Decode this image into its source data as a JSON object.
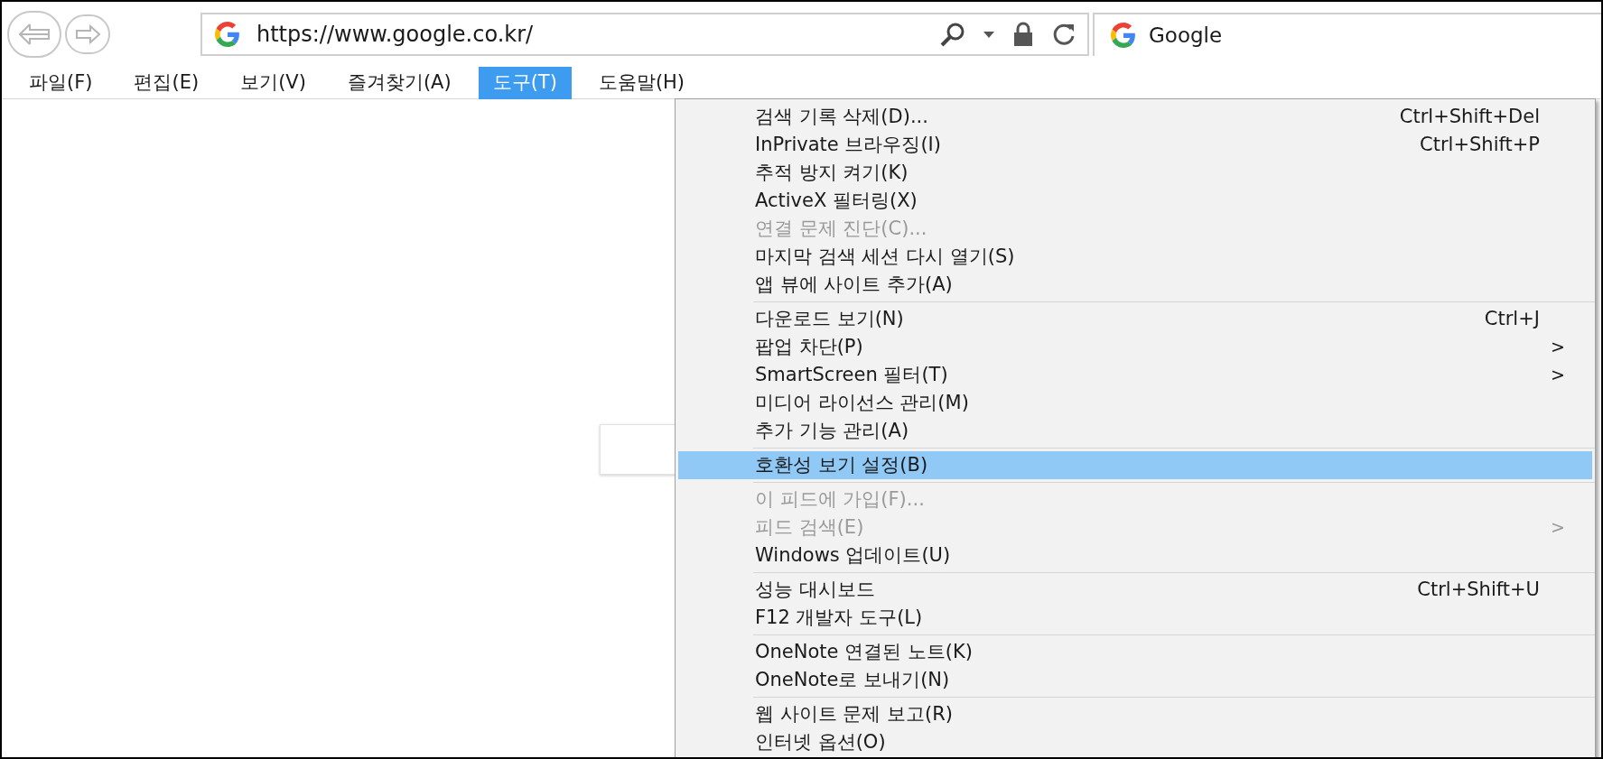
{
  "toolbar": {
    "address": "https://www.google.co.kr/",
    "search_tab": "Google"
  },
  "menu_bar": [
    {
      "label": "파일(F)",
      "selected": false
    },
    {
      "label": "편집(E)",
      "selected": false
    },
    {
      "label": "보기(V)",
      "selected": false
    },
    {
      "label": "즐겨찾기(A)",
      "selected": false
    },
    {
      "label": "도구(T)",
      "selected": true
    },
    {
      "label": "도움말(H)",
      "selected": false
    }
  ],
  "tools_menu": {
    "sections": [
      {
        "items": [
          {
            "label": "검색 기록 삭제(D)...",
            "shortcut": "Ctrl+Shift+Del",
            "disabled": false,
            "selected": false
          },
          {
            "label": "InPrivate 브라우징(I)",
            "shortcut": "Ctrl+Shift+P",
            "disabled": false,
            "selected": false
          },
          {
            "label": "추적 방지 켜기(K)",
            "disabled": false,
            "selected": false
          },
          {
            "label": "ActiveX 필터링(X)",
            "disabled": false,
            "selected": false
          },
          {
            "label": "연결 문제 진단(C)...",
            "disabled": true,
            "selected": false
          },
          {
            "label": "마지막 검색 세션 다시 열기(S)",
            "disabled": false,
            "selected": false
          },
          {
            "label": "앱 뷰에 사이트 추가(A)",
            "disabled": false,
            "selected": false
          }
        ]
      },
      {
        "items": [
          {
            "label": "다운로드 보기(N)",
            "shortcut": "Ctrl+J",
            "disabled": false,
            "selected": false
          },
          {
            "label": "팝업 차단(P)",
            "submenu_arrow": ">",
            "disabled": false,
            "selected": false
          },
          {
            "label": "SmartScreen 필터(T)",
            "submenu_arrow": ">",
            "disabled": false,
            "selected": false
          },
          {
            "label": "미디어 라이선스 관리(M)",
            "disabled": false,
            "selected": false
          },
          {
            "label": "추가 기능 관리(A)",
            "disabled": false,
            "selected": false
          }
        ]
      },
      {
        "items": [
          {
            "label": "호환성 보기 설정(B)",
            "disabled": false,
            "selected": true
          }
        ]
      },
      {
        "items": [
          {
            "label": "이 피드에 가입(F)...",
            "disabled": true,
            "selected": false
          },
          {
            "label": "피드 검색(E)",
            "submenu_arrow": ">",
            "disabled": true,
            "selected": false
          },
          {
            "label": "Windows 업데이트(U)",
            "disabled": false,
            "selected": false
          }
        ]
      },
      {
        "items": [
          {
            "label": "성능 대시보드",
            "shortcut": "Ctrl+Shift+U",
            "disabled": false,
            "selected": false
          },
          {
            "label": "F12 개발자 도구(L)",
            "disabled": false,
            "selected": false
          }
        ]
      },
      {
        "items": [
          {
            "label": "OneNote 연결된 노트(K)",
            "disabled": false,
            "selected": false
          },
          {
            "label": "OneNote로 보내기(N)",
            "disabled": false,
            "selected": false
          }
        ]
      },
      {
        "items": [
          {
            "label": "웹 사이트 문제 보고(R)",
            "disabled": false,
            "selected": false
          },
          {
            "label": "인터넷 옵션(O)",
            "disabled": false,
            "selected": false
          }
        ]
      }
    ]
  }
}
